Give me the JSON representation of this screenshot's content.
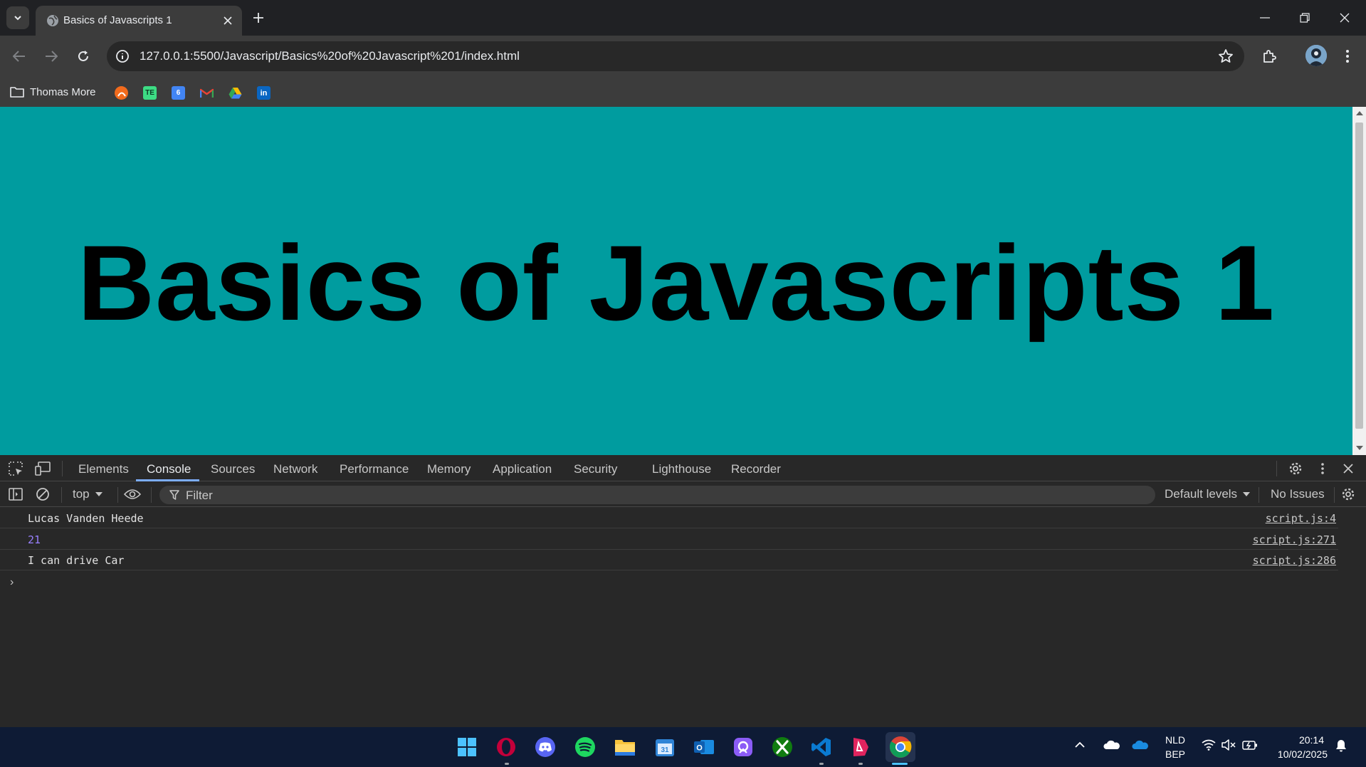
{
  "browser": {
    "tab_title": "Basics of Javascripts 1",
    "url": "127.0.0.1:5500/Javascript/Basics%20of%20Javascript%201/index.html",
    "bookmarks": {
      "folder_label": "Thomas More",
      "items": [
        "brightspace-icon",
        "te-icon",
        "google-calendar-icon",
        "gmail-icon",
        "google-drive-icon",
        "linkedin-icon"
      ]
    }
  },
  "page": {
    "heading": "Basics of Javascripts 1",
    "background_color": "#009c9f"
  },
  "devtools": {
    "tabs": [
      "Elements",
      "Console",
      "Sources",
      "Network",
      "Performance",
      "Memory",
      "Application",
      "Security",
      "Lighthouse",
      "Recorder"
    ],
    "active_tab": "Console",
    "console_toolbar": {
      "context": "top",
      "filter_placeholder": "Filter",
      "levels": "Default levels",
      "issues": "No Issues"
    },
    "logs": [
      {
        "message": "Lucas Vanden Heede",
        "source": "script.js:4",
        "kind": "string"
      },
      {
        "message": "21",
        "source": "script.js:271",
        "kind": "number"
      },
      {
        "message": "I can drive Car",
        "source": "script.js:286",
        "kind": "string"
      }
    ],
    "prompt": "›"
  },
  "taskbar": {
    "apps": [
      "windows-start-icon",
      "opera-icon",
      "discord-icon",
      "spotify-icon",
      "file-explorer-icon",
      "calendar-icon",
      "outlook-icon",
      "proton-icon",
      "xbox-icon",
      "vscode-icon",
      "adobe-icon",
      "chrome-icon"
    ],
    "language": "NLD",
    "layout": "BEP",
    "time": "20:14",
    "date": "10/02/2025"
  }
}
